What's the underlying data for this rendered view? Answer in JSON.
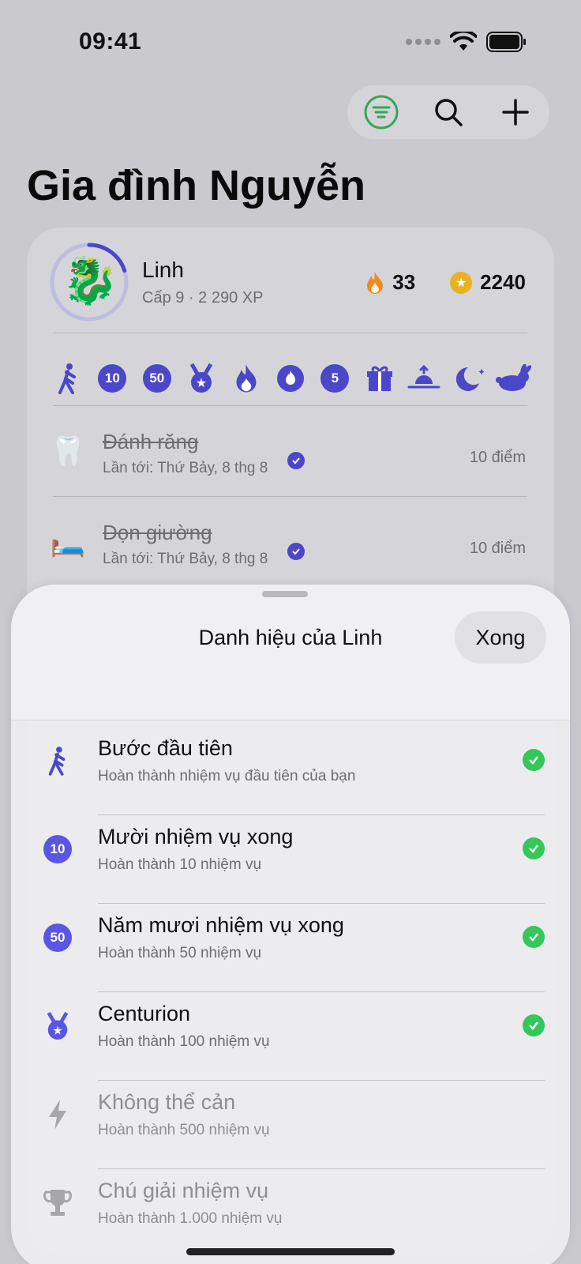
{
  "status_bar": {
    "time": "09:41"
  },
  "toolbar": {
    "filter_icon": "filter-icon",
    "search_icon": "search-icon",
    "add_icon": "plus-icon"
  },
  "page": {
    "title": "Gia đình Nguyễn"
  },
  "profile": {
    "name": "Linh",
    "level": "Cấp 9 · 2 290 XP",
    "level_progress": 0.2,
    "streak": "33",
    "coins": "2240",
    "avatar": "🐉"
  },
  "badges": [
    {
      "icon": "walk-icon",
      "label": ""
    },
    {
      "icon": "badge-10-icon",
      "label": "10"
    },
    {
      "icon": "badge-50-icon",
      "label": "50"
    },
    {
      "icon": "medal-icon",
      "label": ""
    },
    {
      "icon": "flame-icon",
      "label": ""
    },
    {
      "icon": "flame-circle-icon",
      "label": ""
    },
    {
      "icon": "badge-5-icon",
      "label": "5"
    },
    {
      "icon": "gift-icon",
      "label": ""
    },
    {
      "icon": "sunrise-icon",
      "label": ""
    },
    {
      "icon": "moon-stars-icon",
      "label": ""
    },
    {
      "icon": "hare-icon",
      "label": ""
    }
  ],
  "tasks": [
    {
      "emoji": "🦷",
      "title": "Đánh răng",
      "subtitle": "Lần tới: Thứ Bảy, 8 thg 8",
      "points": "10 điểm"
    },
    {
      "emoji": "🛏️",
      "title": "Dọn giường",
      "subtitle": "Lần tới: Thứ Bảy, 8 thg 8",
      "points": "10 điểm"
    }
  ],
  "sheet": {
    "title": "Danh hiệu của Linh",
    "done_label": "Xong",
    "achievements": [
      {
        "icon": "walk-icon",
        "title": "Bước đầu tiên",
        "description": "Hoàn thành nhiệm vụ đầu tiên của bạn",
        "unlocked": true
      },
      {
        "icon": "badge-10-icon",
        "badge": "10",
        "title": "Mười nhiệm vụ xong",
        "description": "Hoàn thành 10 nhiệm vụ",
        "unlocked": true
      },
      {
        "icon": "badge-50-icon",
        "badge": "50",
        "title": "Năm mươi nhiệm vụ xong",
        "description": "Hoàn thành 50 nhiệm vụ",
        "unlocked": true
      },
      {
        "icon": "medal-icon",
        "title": "Centurion",
        "description": "Hoàn thành 100 nhiệm vụ",
        "unlocked": true
      },
      {
        "icon": "bolt-icon",
        "title": "Không thể cản",
        "description": "Hoàn thành 500 nhiệm vụ",
        "unlocked": false
      },
      {
        "icon": "trophy-icon",
        "title": "Chú giải nhiệm vụ",
        "description": "Hoàn thành 1.000 nhiệm vụ",
        "unlocked": false
      }
    ]
  },
  "colors": {
    "accent": "#4b47c9",
    "success": "#34c759",
    "filter_green": "#34a853",
    "flame": "#f08a24",
    "coin": "#e8b323"
  }
}
